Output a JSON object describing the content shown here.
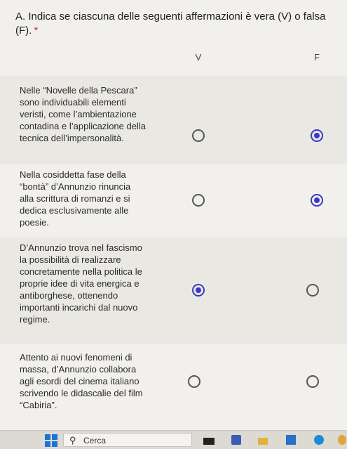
{
  "question": {
    "title": "A. Indica se ciascuna delle seguenti affermazioni è vera (V) o falsa (F).",
    "required_mark": "*",
    "columns": [
      "V",
      "F"
    ]
  },
  "rows": [
    {
      "text": "Nelle “Novelle della Pescara” sono individuabili elementi veristi, come l’ambientazione contadina e l’applicazione della tecnica dell’impersonalità.",
      "selected": "F"
    },
    {
      "text": "Nella cosiddetta fase della “bontà” d’Annunzio rinuncia alla scrittura di romanzi e si dedica esclusivamente alle poesie.",
      "selected": "F"
    },
    {
      "text": "D’Annunzio trova nel fascismo la possibilità di realizzare concretamente nella politica le proprie idee di vita energica e antiborghese, ottenendo importanti incarichi dal nuovo regime.",
      "selected": "V"
    },
    {
      "text": "Attento ai nuovi fenomeni di massa, d’Annunzio collabora agli esordi del cinema italiano scrivendo le didascalie del film “Cabiria”.",
      "selected": ""
    }
  ],
  "taskbar": {
    "search_label": "Cerca",
    "search_icon": "search-icon",
    "accent_color": "#1a73d8"
  },
  "colors": {
    "radio_selected": "#3a3ac8",
    "background": "#f1f0ec",
    "row_alt": "#e9e8e3"
  }
}
